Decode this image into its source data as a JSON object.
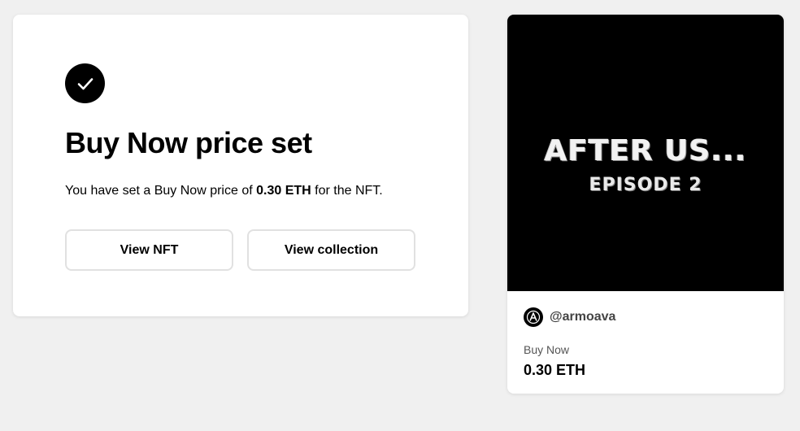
{
  "confirmation": {
    "title": "Buy Now price set",
    "message_prefix": "You have set a Buy Now price of ",
    "message_price": "0.30 ETH",
    "message_suffix": " for the NFT.",
    "view_nft_label": "View NFT",
    "view_collection_label": "View collection",
    "status_icon": "check-icon"
  },
  "nft": {
    "art_title": "AFTER US...",
    "art_subtitle": "EPISODE 2",
    "creator_handle": "@armoava",
    "price_label": "Buy Now",
    "price_value": "0.30 ETH"
  },
  "colors": {
    "background": "#f0f0f0",
    "card": "#ffffff",
    "accent": "#000000",
    "button_border": "#e1e1e1"
  }
}
